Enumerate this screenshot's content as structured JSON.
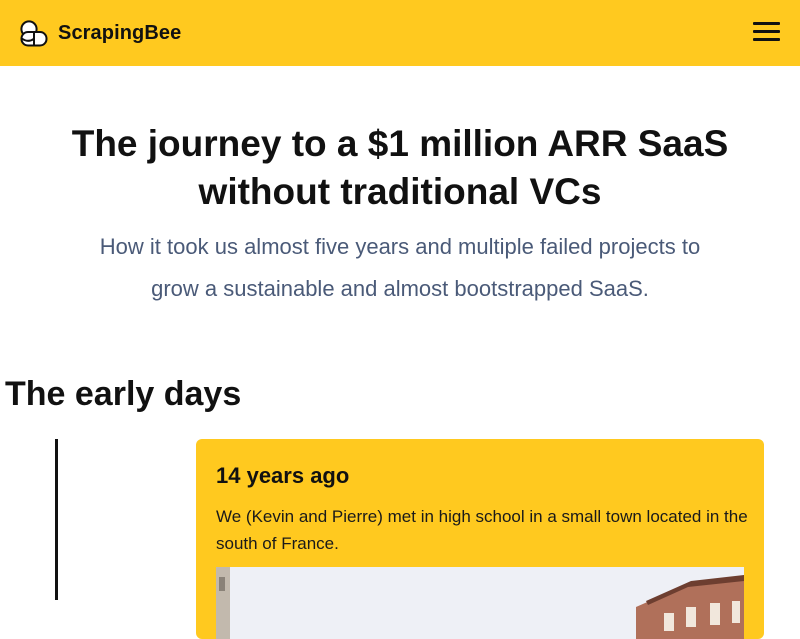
{
  "header": {
    "brand_name": "ScrapingBee",
    "logo_icon": "bee-logo-icon",
    "menu_icon": "hamburger-menu-icon",
    "background_color": "#ffc91f"
  },
  "hero": {
    "title": "The journey to a $1 million ARR SaaS without traditional VCs",
    "subtitle": "How it took us almost five years and multiple failed projects to grow a sustainable and almost bootstrapped SaaS."
  },
  "section": {
    "heading": "The early days"
  },
  "timeline": {
    "items": [
      {
        "title": "14 years ago",
        "text": "We (Kevin and Pierre) met in high school in a small town located in the south of France.",
        "image": "building-photo",
        "card_color": "#ffc91f"
      }
    ]
  }
}
